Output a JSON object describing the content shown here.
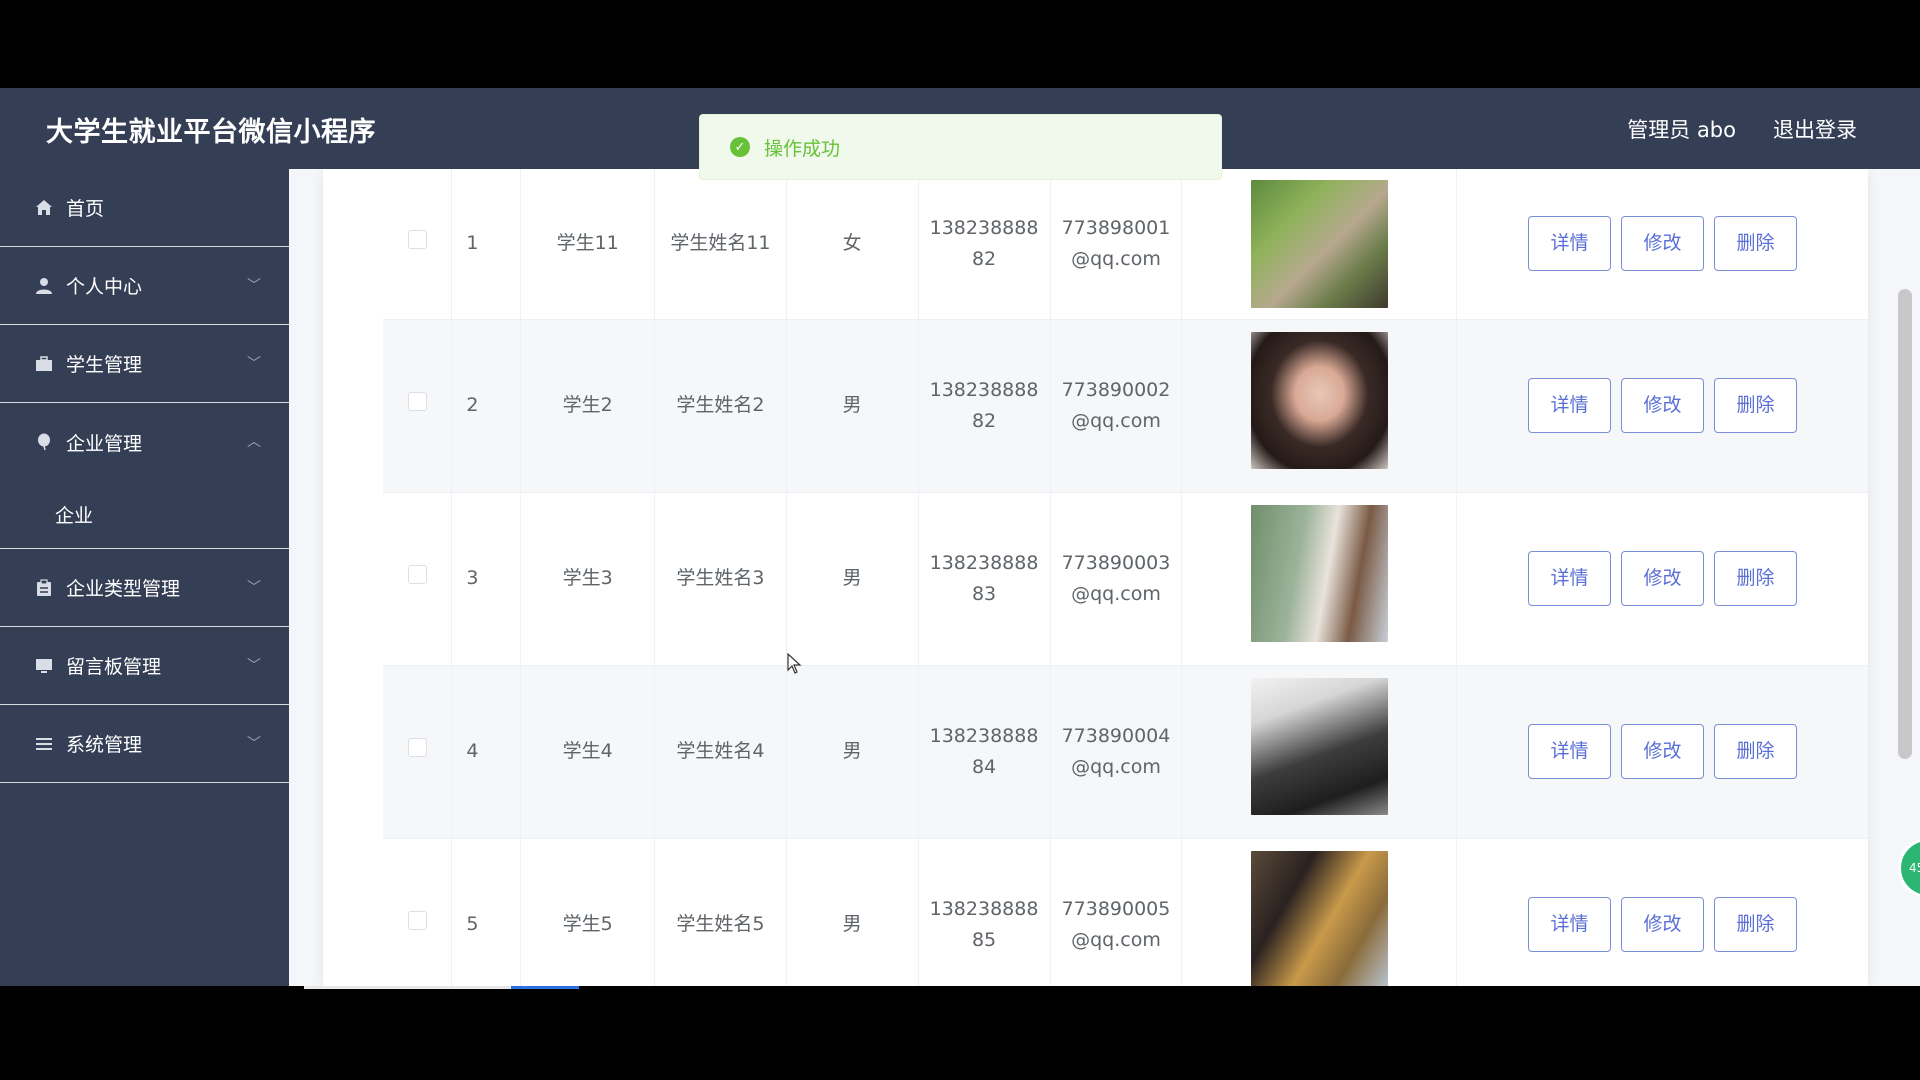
{
  "header": {
    "app_title": "大学生就业平台微信小程序",
    "user_label": "管理员 abo",
    "logout_label": "退出登录"
  },
  "sidebar": {
    "items": [
      {
        "label": "首页",
        "icon": "home-icon",
        "has_chevron": false
      },
      {
        "label": "个人中心",
        "icon": "user-icon",
        "has_chevron": true,
        "expanded": false
      },
      {
        "label": "学生管理",
        "icon": "briefcase-icon",
        "has_chevron": true,
        "expanded": false
      },
      {
        "label": "企业管理",
        "icon": "balloon-icon",
        "has_chevron": true,
        "expanded": true
      },
      {
        "label": "企业类型管理",
        "icon": "clipboard-icon",
        "has_chevron": true,
        "expanded": false
      },
      {
        "label": "留言板管理",
        "icon": "monitor-icon",
        "has_chevron": true,
        "expanded": false
      },
      {
        "label": "系统管理",
        "icon": "list-icon",
        "has_chevron": true,
        "expanded": false
      }
    ],
    "submenu": {
      "parent": "企业管理",
      "items": [
        {
          "label": "企业"
        }
      ]
    }
  },
  "toast": {
    "message": "操作成功",
    "icon": "check-circle-icon",
    "color": "#67c23a"
  },
  "table": {
    "rows": [
      {
        "index": "1",
        "username": "学生11",
        "name": "学生姓名11",
        "sex": "女",
        "phone_1": "138238888",
        "phone_2": "82",
        "email_1": "773898001",
        "email_2": "@qq.com"
      },
      {
        "index": "2",
        "username": "学生2",
        "name": "学生姓名2",
        "sex": "男",
        "phone_1": "138238888",
        "phone_2": "82",
        "email_1": "773890002",
        "email_2": "@qq.com"
      },
      {
        "index": "3",
        "username": "学生3",
        "name": "学生姓名3",
        "sex": "男",
        "phone_1": "138238888",
        "phone_2": "83",
        "email_1": "773890003",
        "email_2": "@qq.com"
      },
      {
        "index": "4",
        "username": "学生4",
        "name": "学生姓名4",
        "sex": "男",
        "phone_1": "138238888",
        "phone_2": "84",
        "email_1": "773890004",
        "email_2": "@qq.com"
      },
      {
        "index": "5",
        "username": "学生5",
        "name": "学生姓名5",
        "sex": "男",
        "phone_1": "138238888",
        "phone_2": "85",
        "email_1": "773890005",
        "email_2": "@qq.com"
      }
    ],
    "buttons": {
      "detail": "详情",
      "edit": "修改",
      "delete": "删除"
    }
  },
  "colors": {
    "header_bg": "#343f56",
    "sidebar_bg": "#343f56",
    "accent": "#5a6fd6",
    "success": "#67c23a"
  }
}
